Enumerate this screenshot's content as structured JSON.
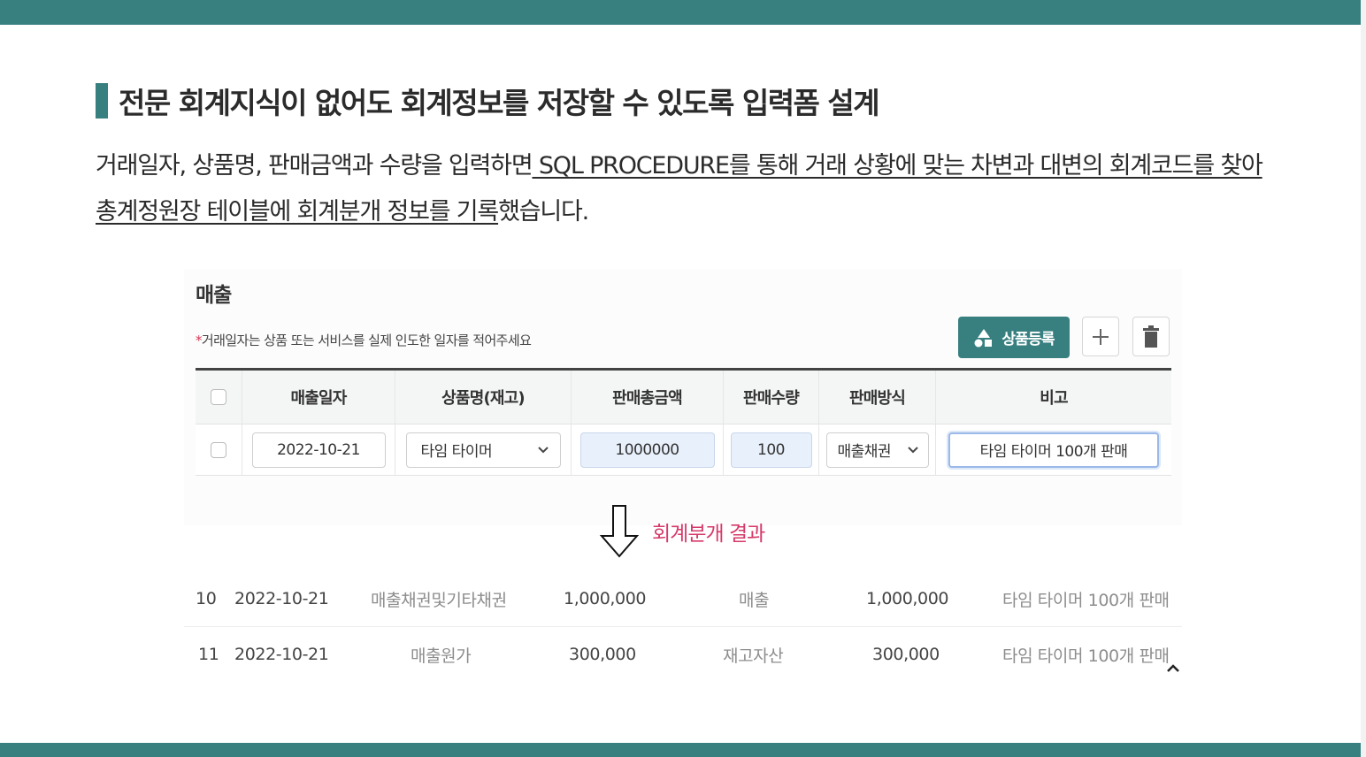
{
  "heading": "전문 회계지식이 없어도 회계정보를 저장할 수 있도록 입력폼 설계",
  "paragraph": {
    "part1": "거래일자, 상품명, 판매금액과 수량을 입력하면",
    "part2": " SQL PROCEDURE를 통해 거래 상황에 맞는 차변과 대변의 회계코드를 찾아 총계정원장 테이블에 회계분개 정보를 기록",
    "part3": "했습니다."
  },
  "form": {
    "title": "매출",
    "note_star": "*",
    "note": "거래일자는 상품 또는 서비스를 실제 인도한 일자를 적어주세요",
    "register_button": "상품등록",
    "columns": [
      "매출일자",
      "상품명(재고)",
      "판매총금액",
      "판매수량",
      "판매방식",
      "비고"
    ],
    "row": {
      "date": "2022-10-21",
      "product": "타임 타이머",
      "total": "1000000",
      "qty": "100",
      "method": "매출채권",
      "memo": "타임 타이머 100개 판매"
    }
  },
  "result_label": "회계분개 결과",
  "journal": [
    {
      "no": "10",
      "date": "2022-10-21",
      "debit_account": "매출채권및기타채권",
      "debit_amount": "1,000,000",
      "credit_account": "매출",
      "credit_amount": "1,000,000",
      "memo": "타임 타이머 100개 판매"
    },
    {
      "no": "11",
      "date": "2022-10-21",
      "debit_account": "매출원가",
      "debit_amount": "300,000",
      "credit_account": "재고자산",
      "credit_amount": "300,000",
      "memo": "타임 타이머 100개 판매"
    }
  ],
  "colors": {
    "accent": "#387f80",
    "result": "#d63a6a"
  },
  "icons": [
    "shapes-icon",
    "plus-icon",
    "trash-icon",
    "chevron-down-icon",
    "arrow-down-icon",
    "chevron-up-icon"
  ]
}
